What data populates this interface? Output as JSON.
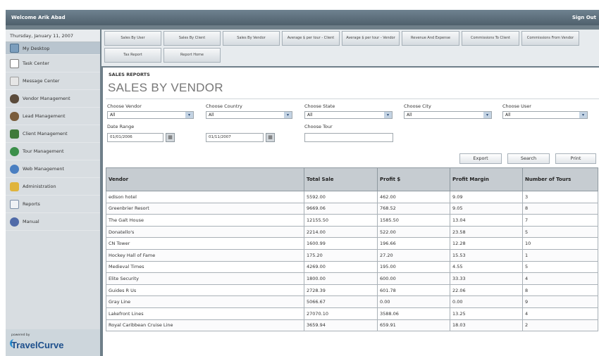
{
  "header": {
    "welcome": "Welcome Arik Abad",
    "signout": "Sign Out"
  },
  "sidebar": {
    "date": "Thursday, January 11, 2007",
    "items": [
      {
        "label": "My Desktop",
        "icon": "desktop-icon"
      },
      {
        "label": "Task Center",
        "icon": "task-icon"
      },
      {
        "label": "Message Center",
        "icon": "message-icon"
      },
      {
        "label": "Vendor Management",
        "icon": "vendor-icon"
      },
      {
        "label": "Lead Management",
        "icon": "lead-icon"
      },
      {
        "label": "Client Management",
        "icon": "client-icon"
      },
      {
        "label": "Tour Management",
        "icon": "tour-icon"
      },
      {
        "label": "Web Management",
        "icon": "web-icon"
      },
      {
        "label": "Administration",
        "icon": "admin-icon"
      },
      {
        "label": "Reports",
        "icon": "reports-icon"
      },
      {
        "label": "Manual",
        "icon": "manual-icon"
      }
    ],
    "logo_powered": "powered by",
    "logo_brand": "TravelCurve"
  },
  "toolbar": {
    "buttons": [
      "Sales By User",
      "Sales By Client",
      "Sales By Vendor",
      "Average $ per tour - Client",
      "Average $ per tour - Vendor",
      "Revenue And Expense",
      "Commissions To Client",
      "Commissions From Vendor",
      "Tax Report",
      "Report Home"
    ]
  },
  "report": {
    "section_label": "SALES REPORTS",
    "title": "SALES BY VENDOR"
  },
  "filters": {
    "vendor_label": "Choose Vendor",
    "vendor_value": "All",
    "country_label": "Choose Country",
    "country_value": "All",
    "state_label": "Choose State",
    "state_value": "All",
    "city_label": "Choose City",
    "city_value": "All",
    "user_label": "Choose User",
    "user_value": "All",
    "date_range_label": "Date Range",
    "date_from": "01/01/2006",
    "date_to": "01/11/2007",
    "tour_label": "Choose Tour",
    "tour_value": ""
  },
  "actions": {
    "export": "Export",
    "search": "Search",
    "print": "Print"
  },
  "table": {
    "columns": [
      "Vendor",
      "Total Sale",
      "Profit $",
      "Profit Margin",
      "Number of Tours"
    ],
    "rows": [
      [
        "edison hotel",
        "5592.00",
        "462.00",
        "9.09",
        "3"
      ],
      [
        "Greenbrier Resort",
        "9669.06",
        "768.52",
        "9.05",
        "8"
      ],
      [
        "The Galt House",
        "12155.50",
        "1585.50",
        "13.04",
        "7"
      ],
      [
        "Donatello's",
        "2214.00",
        "522.00",
        "23.58",
        "5"
      ],
      [
        "CN Tower",
        "1600.99",
        "196.66",
        "12.28",
        "10"
      ],
      [
        "Hockey Hall of Fame",
        "175.20",
        "27.20",
        "15.53",
        "1"
      ],
      [
        "Medieval Times",
        "4269.00",
        "195.00",
        "4.55",
        "5"
      ],
      [
        "Elite Security",
        "1800.00",
        "600.00",
        "33.33",
        "4"
      ],
      [
        "Guides R Us",
        "2728.39",
        "601.78",
        "22.06",
        "8"
      ],
      [
        "Gray Line",
        "5066.67",
        "0.00",
        "0.00",
        "9"
      ],
      [
        "Lakefront Lines",
        "27070.10",
        "3588.06",
        "13.25",
        "4"
      ],
      [
        "Royal Caribbean Cruise Line",
        "3659.94",
        "659.91",
        "18.03",
        "2"
      ]
    ]
  }
}
